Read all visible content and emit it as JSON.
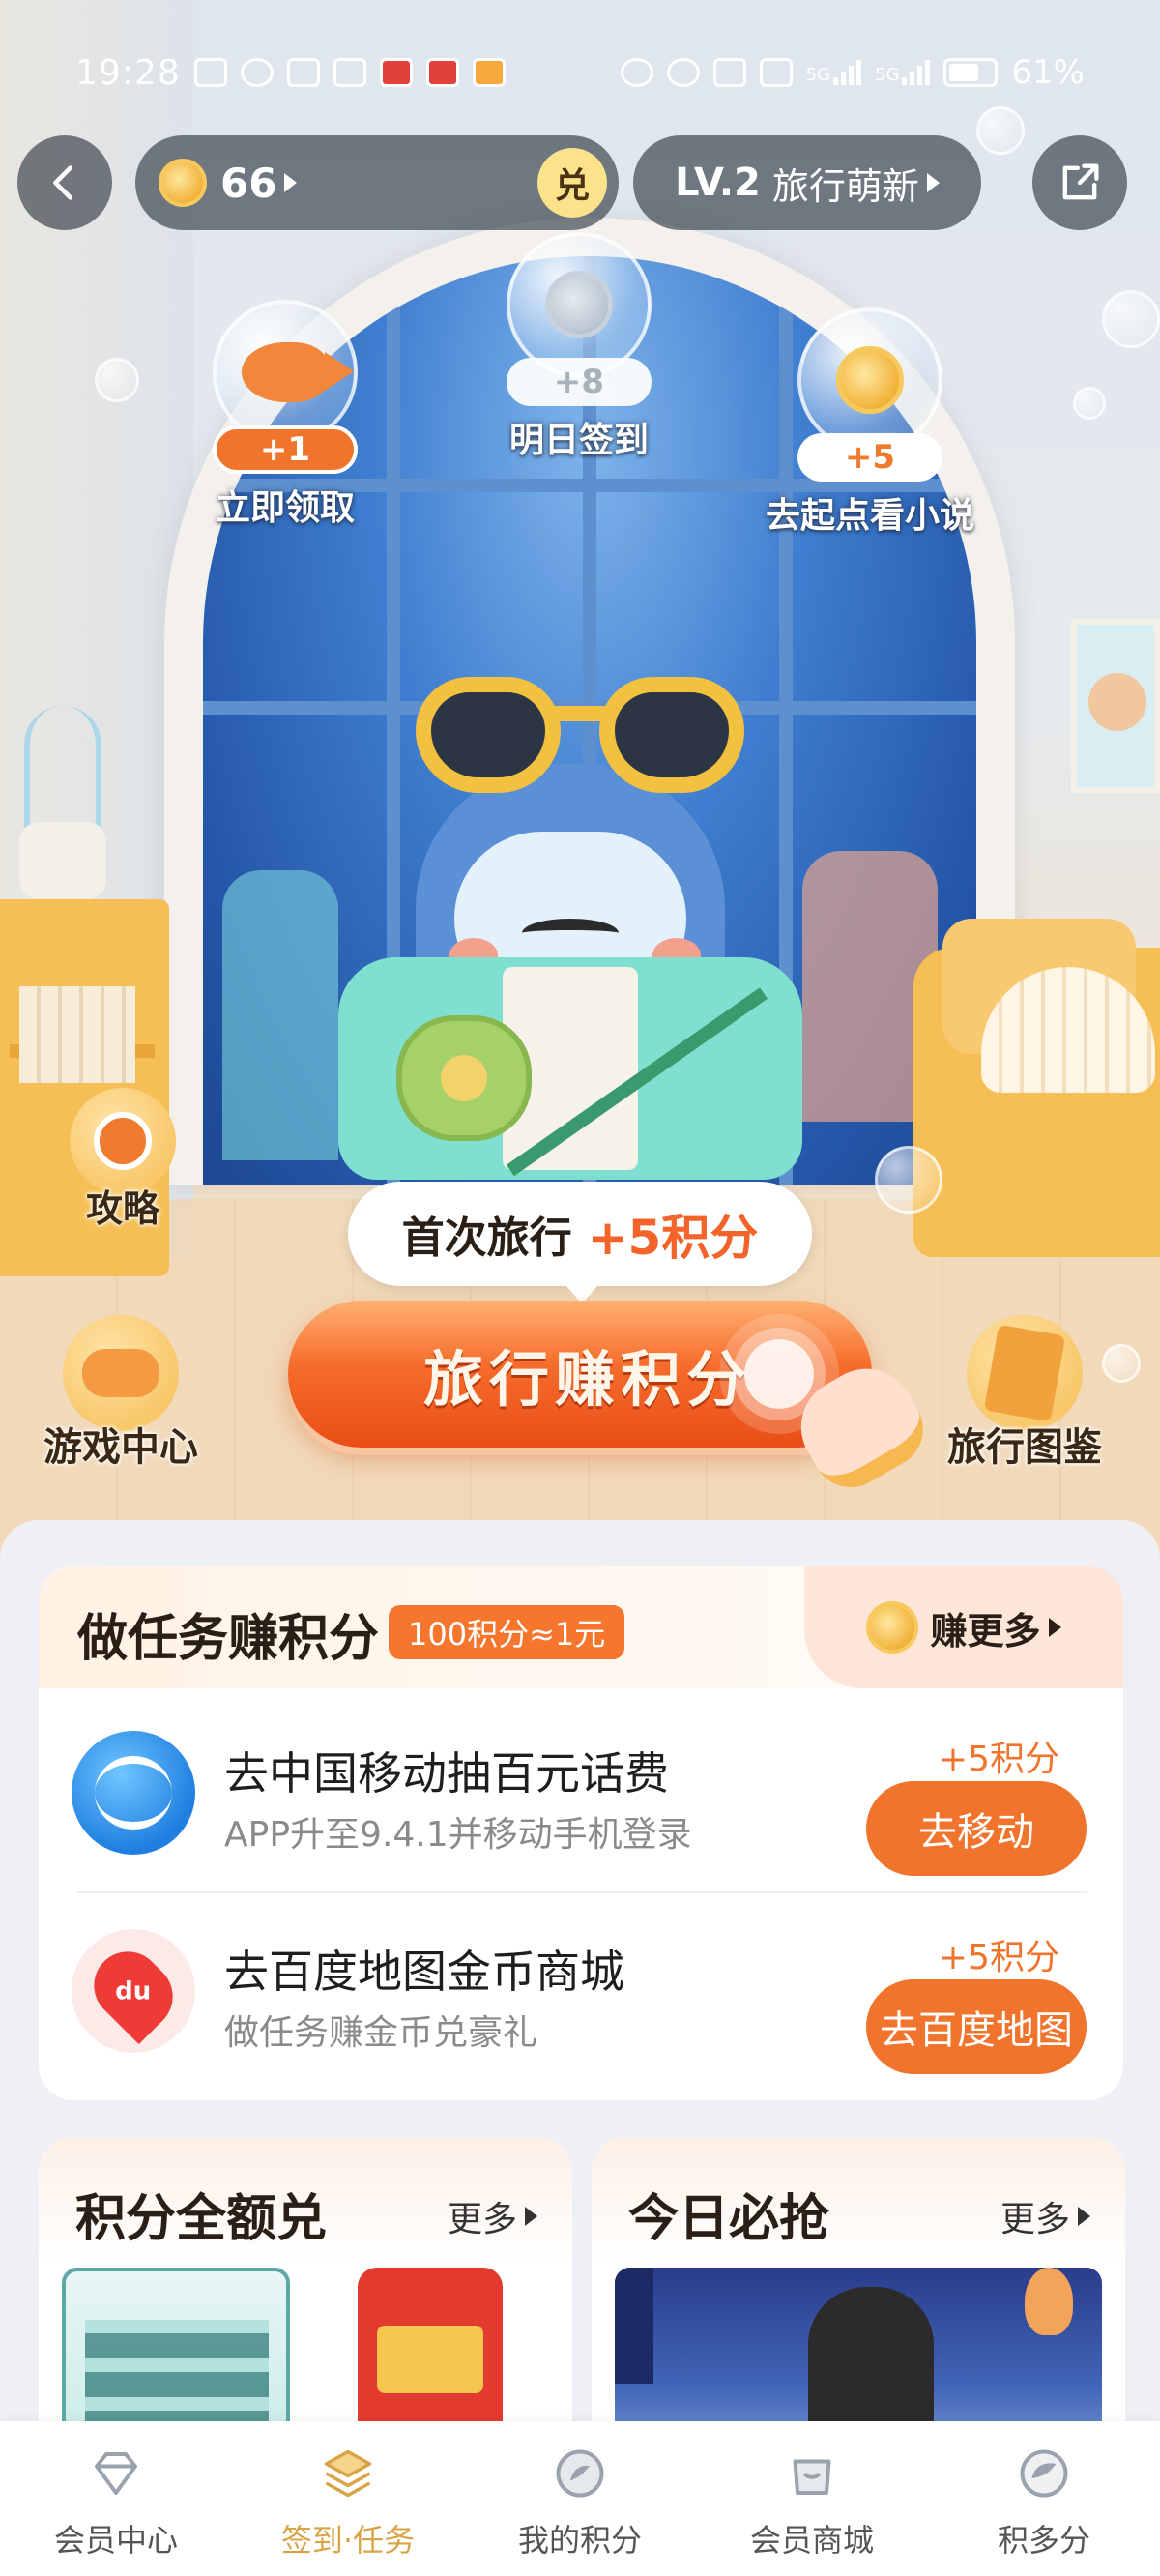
{
  "status_bar": {
    "time": "19:28",
    "signal1": "5G",
    "signal2": "5G",
    "battery": "61%"
  },
  "top_bar": {
    "points": "66",
    "redeem_label": "兑",
    "level_code": "LV.2",
    "level_name": "旅行萌新"
  },
  "rewards": [
    {
      "value": "+1",
      "label": "立即领取"
    },
    {
      "value": "+8",
      "label": "明日签到"
    },
    {
      "value": "+5",
      "label": "去起点看小说"
    }
  ],
  "side_buttons": {
    "guide": "攻略",
    "game_center": "游戏中心",
    "travel_book": "旅行图鉴"
  },
  "cta": {
    "first_trip": "首次旅行",
    "first_trip_points": "+5积分",
    "button": "旅行赚积分"
  },
  "tasks": {
    "title": "做任务赚积分",
    "rate": "100积分≈1元",
    "more": "赚更多",
    "items": [
      {
        "title": "去中国移动抽百元话费",
        "subtitle": "APP升至9.4.1并移动手机登录",
        "points": "+5积分",
        "button": "去移动",
        "logo_text": ""
      },
      {
        "title": "去百度地图金币商城",
        "subtitle": "做任务赚金币兑豪礼",
        "points": "+5积分",
        "button": "去百度地图",
        "logo_text": "du"
      }
    ]
  },
  "cards": {
    "left": {
      "title": "积分全额兑",
      "more": "更多"
    },
    "right": {
      "title": "今日必抢",
      "more": "更多"
    }
  },
  "tabbar": [
    {
      "label": "会员中心"
    },
    {
      "label": "签到·任务"
    },
    {
      "label": "我的积分"
    },
    {
      "label": "会员商城"
    },
    {
      "label": "积多分"
    }
  ],
  "colors": {
    "accent": "#f0742c",
    "active_tab": "#d9a347"
  }
}
